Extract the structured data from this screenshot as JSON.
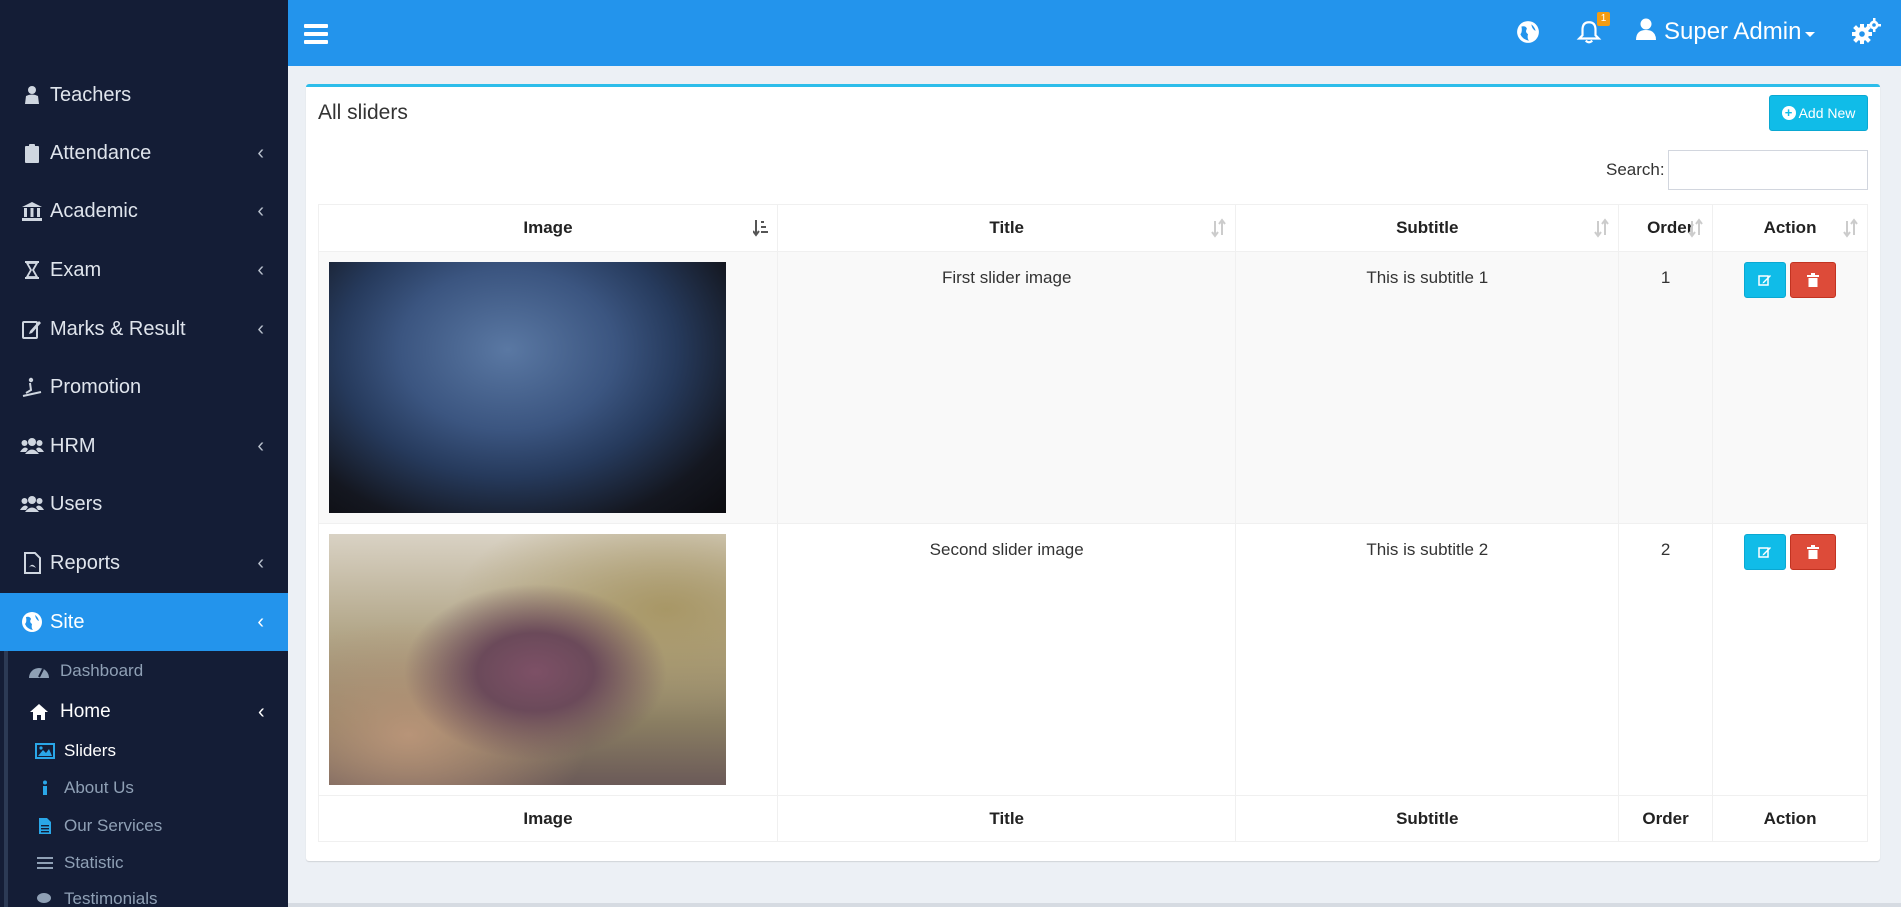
{
  "sidebar": {
    "items": [
      {
        "label": "Teachers",
        "icon": "teacher-icon",
        "expandable": false
      },
      {
        "label": "Attendance",
        "icon": "clipboard-icon",
        "expandable": true
      },
      {
        "label": "Academic",
        "icon": "institution-icon",
        "expandable": true
      },
      {
        "label": "Exam",
        "icon": "hourglass-icon",
        "expandable": true
      },
      {
        "label": "Marks & Result",
        "icon": "edit-document-icon",
        "expandable": true
      },
      {
        "label": "Promotion",
        "icon": "ramp-icon",
        "expandable": false
      },
      {
        "label": "HRM",
        "icon": "users-icon",
        "expandable": true
      },
      {
        "label": "Users",
        "icon": "users-icon",
        "expandable": false
      },
      {
        "label": "Reports",
        "icon": "pdf-icon",
        "expandable": true
      },
      {
        "label": "Site",
        "icon": "globe-icon",
        "expandable": true,
        "active": true
      }
    ],
    "site_submenu": {
      "dashboard": "Dashboard",
      "home": "Home",
      "home_children": [
        "Sliders",
        "About Us",
        "Our Services",
        "Statistic",
        "Testimonials"
      ],
      "current": "Sliders"
    },
    "chevron": "‹"
  },
  "topbar": {
    "notification_count": "1",
    "user_name": "Super Admin"
  },
  "box": {
    "title": "All sliders",
    "add_button": "Add New",
    "search_label": "Search:",
    "search_value": ""
  },
  "table": {
    "columns": [
      "Image",
      "Title",
      "Subtitle",
      "Order",
      "Action"
    ],
    "rows": [
      {
        "image": "blurred-blue-dark-photo",
        "title": "First slider image",
        "subtitle": "This is subtitle 1",
        "order": "1"
      },
      {
        "image": "blurred-warm-tones-photo",
        "title": "Second slider image",
        "subtitle": "This is subtitle 2",
        "order": "2"
      }
    ]
  },
  "colors": {
    "sidebar_bg": "#141d36",
    "primary_blue": "#2394ec",
    "info": "#10bce8",
    "danger": "#dd4b39",
    "badge": "#f39c12"
  }
}
